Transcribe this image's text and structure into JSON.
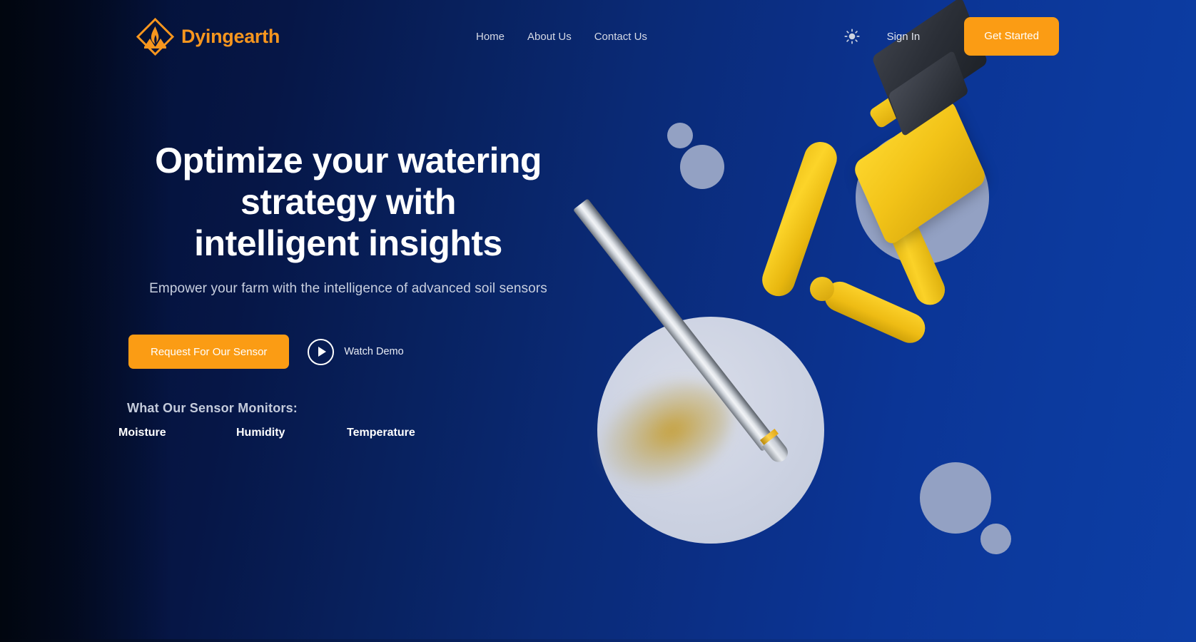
{
  "brand": {
    "name": "Dyingearth",
    "logo_icon": "flame-diamond-logo-icon",
    "accent_color": "#f7961e"
  },
  "nav": {
    "links": [
      {
        "label": "Home"
      },
      {
        "label": "About Us"
      },
      {
        "label": "Contact Us"
      }
    ],
    "theme_toggle_icon": "sun-icon",
    "sign_in_label": "Sign In",
    "get_started_label": "Get Started",
    "get_started_color": "#fb9c14"
  },
  "hero": {
    "title_line1": "Optimize your watering",
    "title_line2": "strategy with",
    "title_line3": "intelligent insights",
    "subtitle": "Empower your farm with the intelligence of advanced soil sensors",
    "primary_cta_label": "Request For Our Sensor",
    "primary_cta_color": "#fb9c14",
    "watch_demo_label": "Watch Demo",
    "play_icon": "play-icon"
  },
  "monitors": {
    "title": "What Our Sensor Monitors:",
    "items": [
      {
        "label": "Moisture"
      },
      {
        "label": "Humidity"
      },
      {
        "label": "Temperature"
      }
    ]
  },
  "graphic": {
    "product_icon": "soil-sensor-probe-image",
    "decor_circle_color": "#93a1c3",
    "big_circle_color": "#ccd2e2",
    "sensor_body_color": "#f2c318"
  }
}
